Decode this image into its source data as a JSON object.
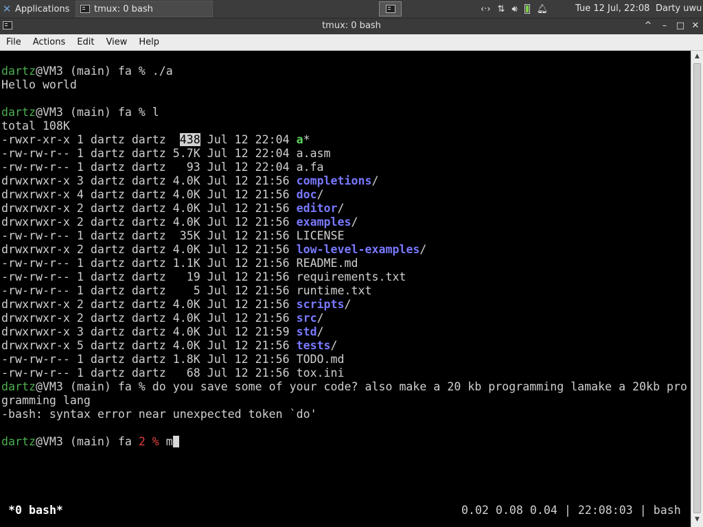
{
  "panel": {
    "applications_label": "Applications",
    "task_label": "tmux: 0 bash",
    "clock": "Tue 12 Jul, 22:08",
    "user": "Darty uwu",
    "tray_icons": [
      "network-icon",
      "transfer-icon",
      "volume-icon",
      "battery-icon",
      "bell-icon"
    ]
  },
  "window": {
    "title": "tmux: 0 bash",
    "controls": [
      "^",
      "–",
      "□",
      "✕"
    ]
  },
  "menu": [
    "File",
    "Actions",
    "Edit",
    "View",
    "Help"
  ],
  "terminal": {
    "lines": [
      [
        {
          "t": "dartz",
          "c": "g"
        },
        {
          "t": "@VM3 (main) fa % ./a"
        }
      ],
      [
        {
          "t": "Hello world"
        }
      ],
      [
        {
          "t": ""
        }
      ],
      [
        {
          "t": "dartz",
          "c": "g"
        },
        {
          "t": "@VM3 (main) fa % l"
        }
      ],
      [
        {
          "t": "total 108K"
        }
      ],
      [
        {
          "t": "-rwxr-xr-x 1 dartz dartz  "
        },
        {
          "t": "438",
          "c": "hl"
        },
        {
          "t": " Jul 12 22:04 "
        },
        {
          "t": "a",
          "c": "x"
        },
        {
          "t": "*"
        }
      ],
      [
        {
          "t": "-rw-rw-r-- 1 dartz dartz 5.7K Jul 12 22:04 a.asm"
        }
      ],
      [
        {
          "t": "-rw-rw-r-- 1 dartz dartz   93 Jul 12 22:04 a.fa"
        }
      ],
      [
        {
          "t": "drwxrwxr-x 3 dartz dartz 4.0K Jul 12 21:56 "
        },
        {
          "t": "completions",
          "c": "b"
        },
        {
          "t": "/"
        }
      ],
      [
        {
          "t": "drwxrwxr-x 4 dartz dartz 4.0K Jul 12 21:56 "
        },
        {
          "t": "doc",
          "c": "b"
        },
        {
          "t": "/"
        }
      ],
      [
        {
          "t": "drwxrwxr-x 2 dartz dartz 4.0K Jul 12 21:56 "
        },
        {
          "t": "editor",
          "c": "b"
        },
        {
          "t": "/"
        }
      ],
      [
        {
          "t": "drwxrwxr-x 2 dartz dartz 4.0K Jul 12 21:56 "
        },
        {
          "t": "examples",
          "c": "b"
        },
        {
          "t": "/"
        }
      ],
      [
        {
          "t": "-rw-rw-r-- 1 dartz dartz  35K Jul 12 21:56 LICENSE"
        }
      ],
      [
        {
          "t": "drwxrwxr-x 2 dartz dartz 4.0K Jul 12 21:56 "
        },
        {
          "t": "low-level-examples",
          "c": "b"
        },
        {
          "t": "/"
        }
      ],
      [
        {
          "t": "-rw-rw-r-- 1 dartz dartz 1.1K Jul 12 21:56 README.md"
        }
      ],
      [
        {
          "t": "-rw-rw-r-- 1 dartz dartz   19 Jul 12 21:56 requirements.txt"
        }
      ],
      [
        {
          "t": "-rw-rw-r-- 1 dartz dartz    5 Jul 12 21:56 runtime.txt"
        }
      ],
      [
        {
          "t": "drwxrwxr-x 2 dartz dartz 4.0K Jul 12 21:56 "
        },
        {
          "t": "scripts",
          "c": "b"
        },
        {
          "t": "/"
        }
      ],
      [
        {
          "t": "drwxrwxr-x 2 dartz dartz 4.0K Jul 12 21:56 "
        },
        {
          "t": "src",
          "c": "b"
        },
        {
          "t": "/"
        }
      ],
      [
        {
          "t": "drwxrwxr-x 3 dartz dartz 4.0K Jul 12 21:59 "
        },
        {
          "t": "std",
          "c": "b"
        },
        {
          "t": "/"
        }
      ],
      [
        {
          "t": "drwxrwxr-x 5 dartz dartz 4.0K Jul 12 21:56 "
        },
        {
          "t": "tests",
          "c": "b"
        },
        {
          "t": "/"
        }
      ],
      [
        {
          "t": "-rw-rw-r-- 1 dartz dartz 1.8K Jul 12 21:56 TODO.md"
        }
      ],
      [
        {
          "t": "-rw-rw-r-- 1 dartz dartz   68 Jul 12 21:56 tox.ini"
        }
      ],
      [
        {
          "t": "dartz",
          "c": "g"
        },
        {
          "t": "@VM3 (main) fa % do you save some of your code? also make a 20 kb programming lamake a 20kb pro"
        }
      ],
      [
        {
          "t": "gramming lang"
        }
      ],
      [
        {
          "t": "-bash: syntax error near unexpected token `do'"
        }
      ],
      [
        {
          "t": ""
        }
      ],
      [
        {
          "t": "dartz",
          "c": "g"
        },
        {
          "t": "@VM3 (main) fa "
        },
        {
          "t": "2 %",
          "c": "r"
        },
        {
          "t": " m"
        },
        {
          "t": "",
          "c": "cursor"
        }
      ]
    ]
  },
  "status": {
    "left": "*0 bash*",
    "right": "0.02 0.08 0.04 | 22:08:03 | bash"
  },
  "colors": {
    "prompt_user": "#4caf50",
    "error_code": "#e04040",
    "directory": "#7878ff",
    "executable": "#5fd75f"
  }
}
